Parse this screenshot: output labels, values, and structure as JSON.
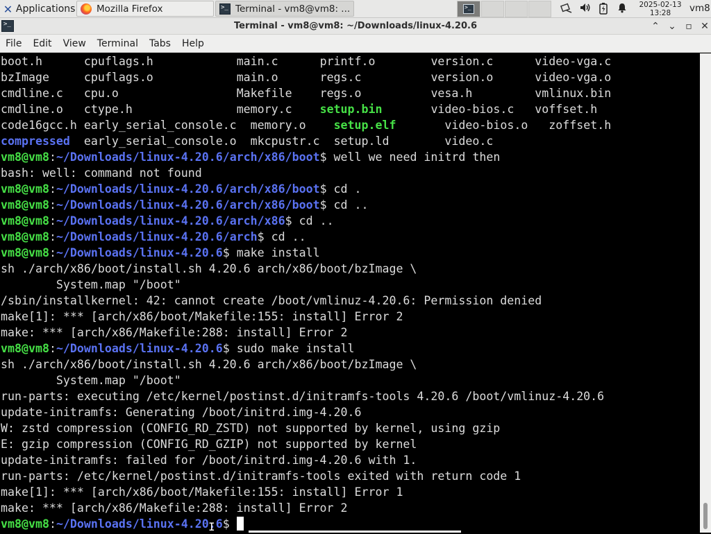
{
  "panel": {
    "applications_label": "Applications",
    "tasks": [
      {
        "label": "Mozilla Firefox",
        "icon": "firefox-icon"
      },
      {
        "label": "Terminal - vm8@vm8: ...",
        "icon": "terminal-icon"
      }
    ],
    "workspaces": [
      "1",
      "2",
      "3",
      "4"
    ],
    "tray_icons": [
      "network-icon",
      "volume-icon",
      "battery-icon",
      "notification-bell-icon"
    ],
    "clock_date": "2025-02-13",
    "clock_time": "13:28",
    "user": "vm8"
  },
  "window": {
    "title": "Terminal - vm8@vm8: ~/Downloads/linux-4.20.6"
  },
  "menubar": {
    "items": [
      "File",
      "Edit",
      "View",
      "Terminal",
      "Tabs",
      "Help"
    ]
  },
  "terminal": {
    "colors": {
      "prompt_user": "#46e046",
      "prompt_path": "#5a72f2",
      "text": "#dcdcdc",
      "background": "#000000"
    },
    "lines": [
      [
        [
          "w",
          "boot.h      "
        ],
        [
          "w",
          "cpuflags.h"
        ],
        [
          "w",
          "            "
        ],
        [
          "w",
          "main.c      "
        ],
        [
          "w",
          "printf.o        "
        ],
        [
          "w",
          "version.c      "
        ],
        [
          "w",
          "video-vga.c"
        ]
      ],
      [
        [
          "w",
          "bzImage     "
        ],
        [
          "w",
          "cpuflags.o"
        ],
        [
          "w",
          "            "
        ],
        [
          "w",
          "main.o      "
        ],
        [
          "w",
          "regs.c          "
        ],
        [
          "w",
          "version.o      "
        ],
        [
          "w",
          "video-vga.o"
        ]
      ],
      [
        [
          "w",
          "cmdline.c   "
        ],
        [
          "w",
          "cpu.o     "
        ],
        [
          "w",
          "            "
        ],
        [
          "w",
          "Makefile    "
        ],
        [
          "w",
          "regs.o          "
        ],
        [
          "w",
          "vesa.h         "
        ],
        [
          "w",
          "vmlinux.bin"
        ]
      ],
      [
        [
          "w",
          "cmdline.o   "
        ],
        [
          "w",
          "ctype.h   "
        ],
        [
          "w",
          "            "
        ],
        [
          "w",
          "memory.c    "
        ],
        [
          "g",
          "setup.bin"
        ],
        [
          "w",
          "       "
        ],
        [
          "w",
          "video-bios.c   "
        ],
        [
          "w",
          "voffset.h"
        ]
      ],
      [
        [
          "w",
          "code16gcc.h "
        ],
        [
          "w",
          "early_serial_console.c  "
        ],
        [
          "w",
          "memory.o    "
        ],
        [
          "g",
          "setup.elf"
        ],
        [
          "w",
          "       "
        ],
        [
          "w",
          "video-bios.o   "
        ],
        [
          "w",
          "zoffset.h"
        ]
      ],
      [
        [
          "b",
          "compressed"
        ],
        [
          "w",
          "  "
        ],
        [
          "w",
          "early_serial_console.o  "
        ],
        [
          "w",
          "mkcpustr.c  "
        ],
        [
          "w",
          "setup.ld        "
        ],
        [
          "w",
          "video.c"
        ]
      ],
      [
        [
          "g",
          "vm8@vm8"
        ],
        [
          "w",
          ":"
        ],
        [
          "b",
          "~/Downloads/linux-4.20.6/arch/x86/boot"
        ],
        [
          "w",
          "$ well we need initrd then"
        ]
      ],
      [
        [
          "w",
          "bash: well: command not found"
        ]
      ],
      [
        [
          "g",
          "vm8@vm8"
        ],
        [
          "w",
          ":"
        ],
        [
          "b",
          "~/Downloads/linux-4.20.6/arch/x86/boot"
        ],
        [
          "w",
          "$ cd ."
        ]
      ],
      [
        [
          "g",
          "vm8@vm8"
        ],
        [
          "w",
          ":"
        ],
        [
          "b",
          "~/Downloads/linux-4.20.6/arch/x86/boot"
        ],
        [
          "w",
          "$ cd .."
        ]
      ],
      [
        [
          "g",
          "vm8@vm8"
        ],
        [
          "w",
          ":"
        ],
        [
          "b",
          "~/Downloads/linux-4.20.6/arch/x86"
        ],
        [
          "w",
          "$ cd .."
        ]
      ],
      [
        [
          "g",
          "vm8@vm8"
        ],
        [
          "w",
          ":"
        ],
        [
          "b",
          "~/Downloads/linux-4.20.6/arch"
        ],
        [
          "w",
          "$ cd .."
        ]
      ],
      [
        [
          "g",
          "vm8@vm8"
        ],
        [
          "w",
          ":"
        ],
        [
          "b",
          "~/Downloads/linux-4.20.6"
        ],
        [
          "w",
          "$ make install"
        ]
      ],
      [
        [
          "w",
          "sh ./arch/x86/boot/install.sh 4.20.6 arch/x86/boot/bzImage \\"
        ]
      ],
      [
        [
          "w",
          "        System.map \"/boot\""
        ]
      ],
      [
        [
          "w",
          "/sbin/installkernel: 42: cannot create /boot/vmlinuz-4.20.6: Permission denied"
        ]
      ],
      [
        [
          "w",
          "make[1]: *** [arch/x86/boot/Makefile:155: install] Error 2"
        ]
      ],
      [
        [
          "w",
          "make: *** [arch/x86/Makefile:288: install] Error 2"
        ]
      ],
      [
        [
          "g",
          "vm8@vm8"
        ],
        [
          "w",
          ":"
        ],
        [
          "b",
          "~/Downloads/linux-4.20.6"
        ],
        [
          "w",
          "$ sudo make install"
        ]
      ],
      [
        [
          "w",
          "sh ./arch/x86/boot/install.sh 4.20.6 arch/x86/boot/bzImage \\"
        ]
      ],
      [
        [
          "w",
          "        System.map \"/boot\""
        ]
      ],
      [
        [
          "w",
          "run-parts: executing /etc/kernel/postinst.d/initramfs-tools 4.20.6 /boot/vmlinuz-4.20.6"
        ]
      ],
      [
        [
          "w",
          "update-initramfs: Generating /boot/initrd.img-4.20.6"
        ]
      ],
      [
        [
          "w",
          "W: zstd compression (CONFIG_RD_ZSTD) not supported by kernel, using gzip"
        ]
      ],
      [
        [
          "w",
          "E: gzip compression (CONFIG_RD_GZIP) not supported by kernel"
        ]
      ],
      [
        [
          "w",
          "update-initramfs: failed for /boot/initrd.img-4.20.6 with 1."
        ]
      ],
      [
        [
          "w",
          "run-parts: /etc/kernel/postinst.d/initramfs-tools exited with return code 1"
        ]
      ],
      [
        [
          "w",
          "make[1]: *** [arch/x86/boot/Makefile:155: install] Error 1"
        ]
      ],
      [
        [
          "w",
          "make: *** [arch/x86/Makefile:288: install] Error 2"
        ]
      ],
      [
        [
          "g",
          "vm8@vm8"
        ],
        [
          "w",
          ":"
        ],
        [
          "b",
          "~/Downloads/linux-4.20.6"
        ],
        [
          "w",
          "$ "
        ]
      ]
    ]
  }
}
